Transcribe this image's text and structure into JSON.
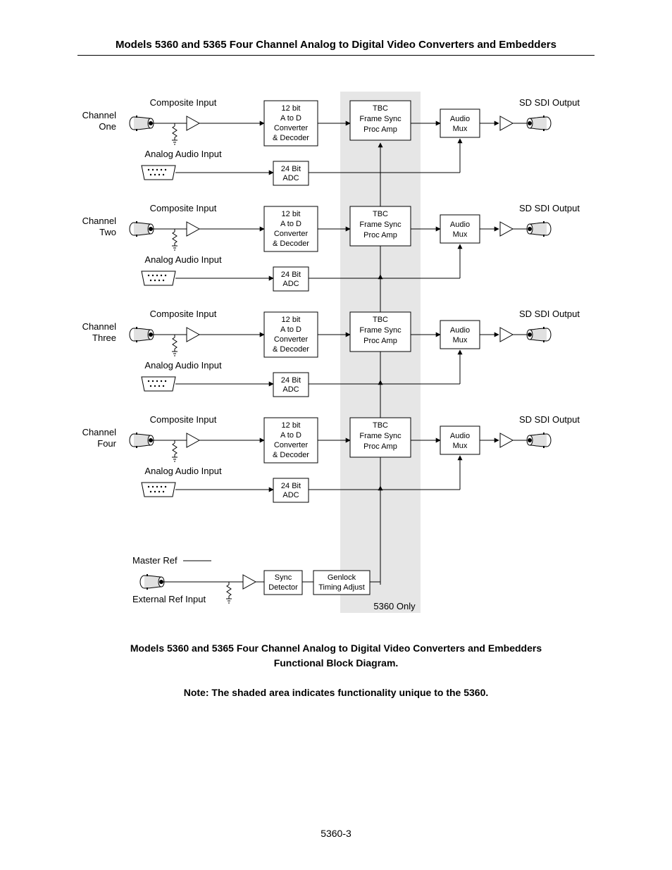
{
  "header": "Models 5360 and 5365 Four Channel Analog to Digital Video Converters and Embedders",
  "caption_line1": "Models 5360 and 5365 Four Channel Analog to Digital Video Converters and Embedders",
  "caption_line2": "Functional Block Diagram.",
  "note": "Note: The shaded area indicates functionality unique to the 5360.",
  "footer": "5360-3",
  "channels": [
    {
      "name": "Channel",
      "name2": "One"
    },
    {
      "name": "Channel",
      "name2": "Two"
    },
    {
      "name": "Channel",
      "name2": "Three"
    },
    {
      "name": "Channel",
      "name2": "Four"
    }
  ],
  "labels": {
    "composite": "Composite Input",
    "analog_audio": "Analog Audio Input",
    "sdi_output": "SD SDI Output",
    "adc12_l1": "12 bit",
    "adc12_l2": "A to D",
    "adc12_l3": "Converter",
    "adc12_l4": "& Decoder",
    "tbc_l1": "TBC",
    "tbc_l2": "Frame Sync",
    "tbc_l3": "Proc Amp",
    "mux_l1": "Audio",
    "mux_l2": "Mux",
    "adc24_l1": "24 Bit",
    "adc24_l2": "ADC",
    "master_ref": "Master Ref",
    "ext_ref": "External Ref Input",
    "sync_l1": "Sync",
    "sync_l2": "Detector",
    "genlock_l1": "Genlock",
    "genlock_l2": "Timing Adjust",
    "only_5360": "5360 Only"
  }
}
